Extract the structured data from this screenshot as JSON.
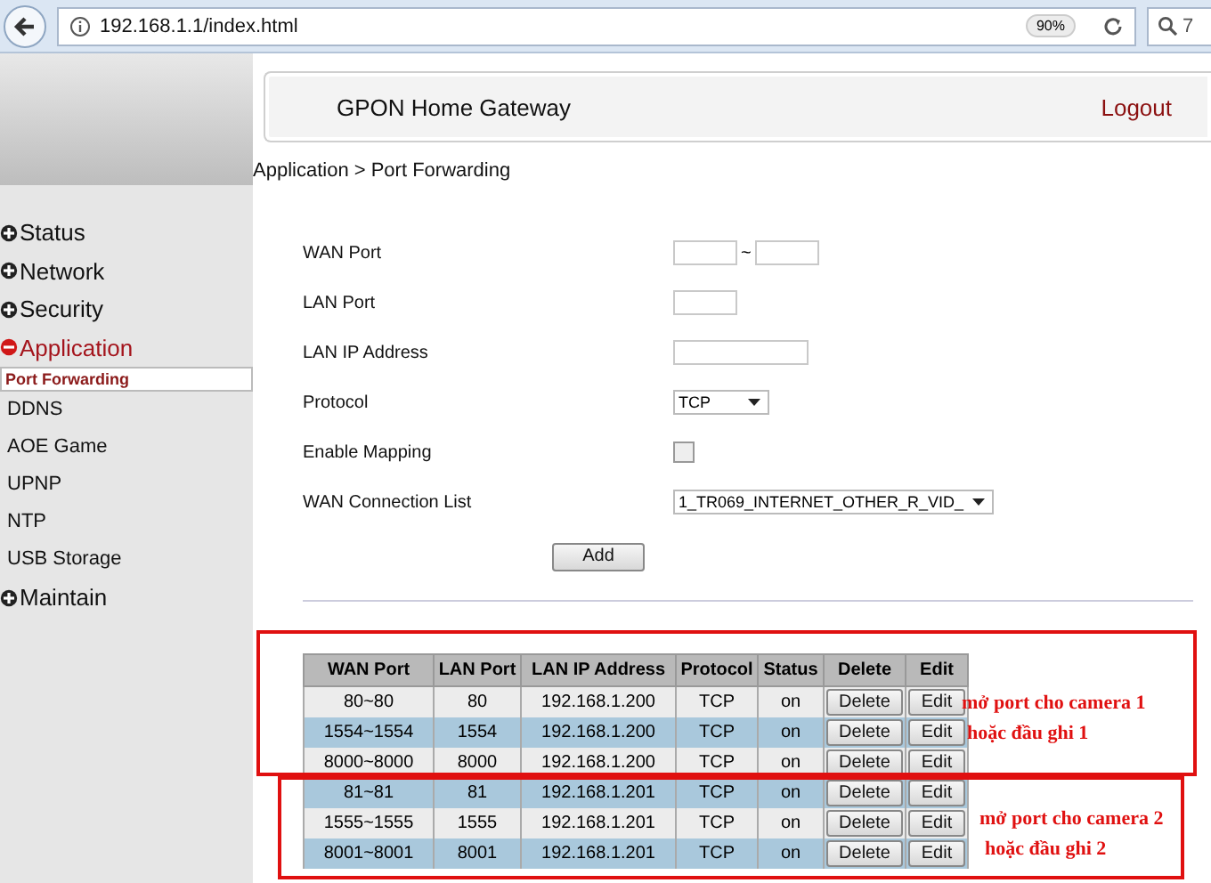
{
  "browser": {
    "url": "192.168.1.1/index.html",
    "zoom": "90%",
    "search_text": "7"
  },
  "header": {
    "title": "GPON Home Gateway",
    "logout": "Logout"
  },
  "breadcrumb": "Application > Port Forwarding",
  "sidebar": {
    "items": [
      {
        "kind": "group",
        "label": "Status",
        "expanded": false
      },
      {
        "kind": "group",
        "label": "Network",
        "expanded": false
      },
      {
        "kind": "group",
        "label": "Security",
        "expanded": false
      },
      {
        "kind": "group",
        "label": "Application",
        "expanded": true,
        "children": [
          {
            "label": "Port Forwarding",
            "selected": true
          },
          {
            "label": "DDNS",
            "selected": false
          },
          {
            "label": "AOE Game",
            "selected": false
          },
          {
            "label": "UPNP",
            "selected": false
          },
          {
            "label": "NTP",
            "selected": false
          },
          {
            "label": "USB Storage",
            "selected": false
          }
        ]
      },
      {
        "kind": "group",
        "label": "Maintain",
        "expanded": false
      }
    ]
  },
  "form": {
    "fields": [
      {
        "kind": "range",
        "label": "WAN Port",
        "separator": "~"
      },
      {
        "kind": "short",
        "label": "LAN Port"
      },
      {
        "kind": "long",
        "label": "LAN IP Address"
      },
      {
        "kind": "select",
        "label": "Protocol",
        "value": "TCP"
      },
      {
        "kind": "checkbox",
        "label": "Enable Mapping",
        "checked": false
      },
      {
        "kind": "wide_select",
        "label": "WAN Connection List",
        "value": "1_TR069_INTERNET_OTHER_R_VID_"
      }
    ],
    "add_button": "Add"
  },
  "table": {
    "columns": [
      "WAN Port",
      "LAN Port",
      "LAN IP Address",
      "Protocol",
      "Status",
      "Delete",
      "Edit"
    ],
    "rows": [
      {
        "wan_port": "80~80",
        "lan_port": "80",
        "lan_ip": "192.168.1.200",
        "protocol": "TCP",
        "status": "on",
        "delete": "Delete",
        "edit": "Edit"
      },
      {
        "wan_port": "1554~1554",
        "lan_port": "1554",
        "lan_ip": "192.168.1.200",
        "protocol": "TCP",
        "status": "on",
        "delete": "Delete",
        "edit": "Edit"
      },
      {
        "wan_port": "8000~8000",
        "lan_port": "8000",
        "lan_ip": "192.168.1.200",
        "protocol": "TCP",
        "status": "on",
        "delete": "Delete",
        "edit": "Edit"
      },
      {
        "wan_port": "81~81",
        "lan_port": "81",
        "lan_ip": "192.168.1.201",
        "protocol": "TCP",
        "status": "on",
        "delete": "Delete",
        "edit": "Edit"
      },
      {
        "wan_port": "1555~1555",
        "lan_port": "1555",
        "lan_ip": "192.168.1.201",
        "protocol": "TCP",
        "status": "on",
        "delete": "Delete",
        "edit": "Edit"
      },
      {
        "wan_port": "8001~8001",
        "lan_port": "8001",
        "lan_ip": "192.168.1.201",
        "protocol": "TCP",
        "status": "on",
        "delete": "Delete",
        "edit": "Edit"
      }
    ]
  },
  "annotations": [
    {
      "lines": [
        "mở port cho camera 1",
        "hoặc đầu ghi 1"
      ]
    },
    {
      "lines": [
        "mở port cho camera 2",
        "hoặc đầu ghi 2"
      ]
    }
  ]
}
